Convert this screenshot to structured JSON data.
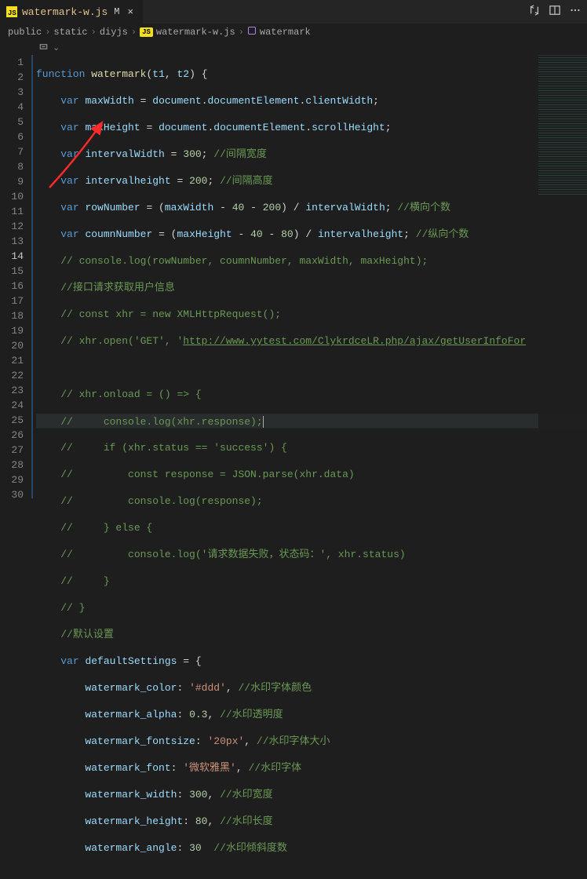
{
  "tab": {
    "filename": "watermark-w.js",
    "modified_indicator": "M"
  },
  "breadcrumbs": {
    "p1": "public",
    "p2": "static",
    "p3": "diyjs",
    "p4": "watermark-w.js",
    "sym": "watermark"
  },
  "subbar": {
    "collapse_glyph": "⌄"
  },
  "code": {
    "l1a": "function",
    "l1b": "watermark",
    "l1c": "t1",
    "l1d": "t2",
    "l2a": "var",
    "l2b": "maxWidth",
    "l2c": "document",
    "l2d": "documentElement",
    "l2e": "clientWidth",
    "l3a": "var",
    "l3b": "maxHeight",
    "l3c": "document",
    "l3d": "documentElement",
    "l3e": "scrollHeight",
    "l4a": "var",
    "l4b": "intervalWidth",
    "l4c": "300",
    "l4d": "//间隔宽度",
    "l5a": "var",
    "l5b": "intervalheight",
    "l5c": "200",
    "l5d": "//间隔高度",
    "l6a": "var",
    "l6b": "rowNumber",
    "l6c": "maxWidth",
    "l6d": "40",
    "l6e": "200",
    "l6f": "intervalWidth",
    "l6g": "//横向个数",
    "l7a": "var",
    "l7b": "coumnNumber",
    "l7c": "maxHeight",
    "l7d": "40",
    "l7e": "80",
    "l7f": "intervalheight",
    "l7g": "//纵向个数",
    "l8": "// console.log(rowNumber, coumnNumber, maxWidth, maxHeight);",
    "l9": "//接口请求获取用户信息",
    "l10": "// const xhr = new XMLHttpRequest();",
    "l11a": "// xhr.open('GET', '",
    "l11b": "http://www.yytest.com/ClykrdceLR.php/ajax/getUserInfoFor",
    "l13": "// xhr.onload = () => {",
    "l14": "//     console.log(xhr.response);",
    "l15": "//     if (xhr.status == 'success') {",
    "l16": "//         const response = JSON.parse(xhr.data)",
    "l17": "//         console.log(response);",
    "l18": "//     } else {",
    "l19": "//         console.log('请求数据失败，状态码：', xhr.status)",
    "l20": "//     }",
    "l21": "// }",
    "l22": "//默认设置",
    "l23a": "var",
    "l23b": "defaultSettings",
    "l24a": "watermark_color",
    "l24b": "'#ddd'",
    "l24c": "//水印字体颜色",
    "l25a": "watermark_alpha",
    "l25b": "0.3",
    "l25c": "//水印透明度",
    "l26a": "watermark_fontsize",
    "l26b": "'20px'",
    "l26c": "//水印字体大小",
    "l27a": "watermark_font",
    "l27b": "'微软雅黑'",
    "l27c": "//水印字体",
    "l28a": "watermark_width",
    "l28b": "300",
    "l28c": "//水印宽度",
    "l29a": "watermark_height",
    "l29b": "80",
    "l29c": "//水印长度",
    "l30a": "watermark_angle",
    "l30b": "30",
    "l30c": "//水印倾斜度数"
  },
  "lines": [
    "1",
    "2",
    "3",
    "4",
    "5",
    "6",
    "7",
    "8",
    "9",
    "10",
    "11",
    "12",
    "13",
    "14",
    "15",
    "16",
    "17",
    "18",
    "19",
    "20",
    "21",
    "22",
    "23",
    "24",
    "25",
    "26",
    "27",
    "28",
    "29",
    "30"
  ]
}
